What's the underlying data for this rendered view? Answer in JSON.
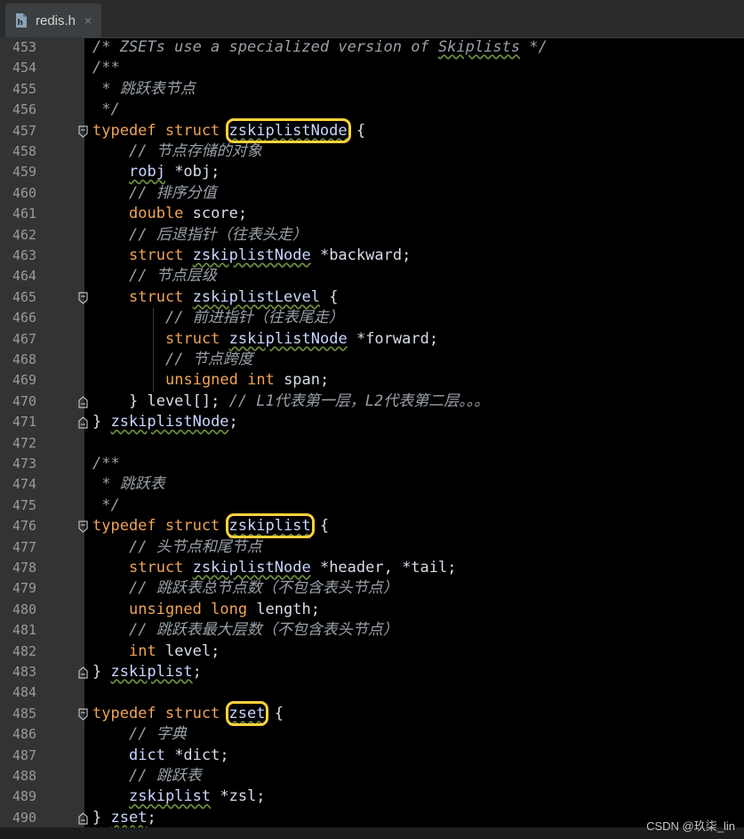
{
  "tab": {
    "filename": "redis.h",
    "close_glyph": "×"
  },
  "watermark": "CSDN @玖柒_lin",
  "colors": {
    "keyword": "#f0a357",
    "comment": "#9aa0a8",
    "highlight_box": "#ffd23b",
    "background": "#000000"
  },
  "lines": [
    {
      "n": "453",
      "indent": 0,
      "parts": [
        [
          "cm",
          "/* ZSETs use a specialized version of "
        ],
        [
          "cm sq",
          "Skiplists"
        ],
        [
          "cm",
          " */"
        ]
      ]
    },
    {
      "n": "454",
      "indent": 0,
      "parts": [
        [
          "cm",
          "/**"
        ]
      ]
    },
    {
      "n": "455",
      "indent": 0,
      "parts": [
        [
          "cm",
          " * 跳跃表节点"
        ]
      ]
    },
    {
      "n": "456",
      "indent": 0,
      "parts": [
        [
          "cm",
          " */"
        ]
      ]
    },
    {
      "n": "457",
      "indent": 0,
      "fold": "open",
      "parts": [
        [
          "kw",
          "typedef struct "
        ],
        [
          "ty sq hl",
          "zskiplistNode"
        ],
        [
          "id",
          " {"
        ]
      ]
    },
    {
      "n": "458",
      "indent": 1,
      "parts": [
        [
          "cm",
          "// 节点存储的对象"
        ]
      ]
    },
    {
      "n": "459",
      "indent": 1,
      "parts": [
        [
          "ty sq",
          "robj"
        ],
        [
          "id",
          " *obj;"
        ]
      ]
    },
    {
      "n": "460",
      "indent": 1,
      "parts": [
        [
          "cm",
          "// 排序分值"
        ]
      ]
    },
    {
      "n": "461",
      "indent": 1,
      "parts": [
        [
          "kw",
          "double "
        ],
        [
          "id",
          "score;"
        ]
      ]
    },
    {
      "n": "462",
      "indent": 1,
      "parts": [
        [
          "cm",
          "// 后退指针（往表头走）"
        ]
      ]
    },
    {
      "n": "463",
      "indent": 1,
      "parts": [
        [
          "kw",
          "struct "
        ],
        [
          "ty sq",
          "zskiplistNode"
        ],
        [
          "id",
          " *backward;"
        ]
      ]
    },
    {
      "n": "464",
      "indent": 1,
      "parts": [
        [
          "cm",
          "// 节点层级"
        ]
      ]
    },
    {
      "n": "465",
      "indent": 1,
      "fold": "open",
      "parts": [
        [
          "kw",
          "struct "
        ],
        [
          "ty sq",
          "zskiplistLevel"
        ],
        [
          "id",
          " {"
        ]
      ]
    },
    {
      "n": "466",
      "indent": 2,
      "parts": [
        [
          "cm",
          "// 前进指针（往表尾走）"
        ]
      ]
    },
    {
      "n": "467",
      "indent": 2,
      "parts": [
        [
          "kw",
          "struct "
        ],
        [
          "ty sq",
          "zskiplistNode"
        ],
        [
          "id",
          " *forward;"
        ]
      ]
    },
    {
      "n": "468",
      "indent": 2,
      "parts": [
        [
          "cm",
          "// 节点跨度"
        ]
      ]
    },
    {
      "n": "469",
      "indent": 2,
      "parts": [
        [
          "kw",
          "unsigned int "
        ],
        [
          "id",
          "span;"
        ]
      ]
    },
    {
      "n": "470",
      "indent": 1,
      "fold": "close",
      "parts": [
        [
          "id",
          "} level[]; "
        ],
        [
          "cm",
          "// L1代表第一层，L2代表第二层。。。"
        ]
      ]
    },
    {
      "n": "471",
      "indent": 0,
      "fold": "close",
      "parts": [
        [
          "id",
          "} "
        ],
        [
          "ty sq",
          "zskiplistNode"
        ],
        [
          "id",
          ";"
        ]
      ]
    },
    {
      "n": "472",
      "indent": 0,
      "parts": []
    },
    {
      "n": "473",
      "indent": 0,
      "parts": [
        [
          "cm",
          "/**"
        ]
      ]
    },
    {
      "n": "474",
      "indent": 0,
      "parts": [
        [
          "cm",
          " * 跳跃表"
        ]
      ]
    },
    {
      "n": "475",
      "indent": 0,
      "parts": [
        [
          "cm",
          " */"
        ]
      ]
    },
    {
      "n": "476",
      "indent": 0,
      "fold": "open",
      "parts": [
        [
          "kw",
          "typedef struct "
        ],
        [
          "ty sq hl",
          "zskiplist"
        ],
        [
          "id",
          " {"
        ]
      ]
    },
    {
      "n": "477",
      "indent": 1,
      "parts": [
        [
          "cm",
          "// 头节点和尾节点"
        ]
      ]
    },
    {
      "n": "478",
      "indent": 1,
      "parts": [
        [
          "kw",
          "struct "
        ],
        [
          "ty sq",
          "zskiplistNode"
        ],
        [
          "id",
          " *header, *tail;"
        ]
      ]
    },
    {
      "n": "479",
      "indent": 1,
      "parts": [
        [
          "cm",
          "// 跳跃表总节点数（不包含表头节点）"
        ]
      ]
    },
    {
      "n": "480",
      "indent": 1,
      "parts": [
        [
          "kw",
          "unsigned long "
        ],
        [
          "id",
          "length;"
        ]
      ]
    },
    {
      "n": "481",
      "indent": 1,
      "parts": [
        [
          "cm",
          "// 跳跃表最大层数（不包含表头节点）"
        ]
      ]
    },
    {
      "n": "482",
      "indent": 1,
      "parts": [
        [
          "kw",
          "int "
        ],
        [
          "id",
          "level;"
        ]
      ]
    },
    {
      "n": "483",
      "indent": 0,
      "fold": "close",
      "parts": [
        [
          "id",
          "} "
        ],
        [
          "ty sq",
          "zskiplist"
        ],
        [
          "id",
          ";"
        ]
      ]
    },
    {
      "n": "484",
      "indent": 0,
      "parts": []
    },
    {
      "n": "485",
      "indent": 0,
      "fold": "open",
      "parts": [
        [
          "kw",
          "typedef struct "
        ],
        [
          "ty sq hl",
          "zset"
        ],
        [
          "id",
          " {"
        ]
      ]
    },
    {
      "n": "486",
      "indent": 1,
      "parts": [
        [
          "cm",
          "// 字典"
        ]
      ]
    },
    {
      "n": "487",
      "indent": 1,
      "parts": [
        [
          "ty",
          "dict"
        ],
        [
          "id",
          " *dict;"
        ]
      ]
    },
    {
      "n": "488",
      "indent": 1,
      "parts": [
        [
          "cm",
          "// 跳跃表"
        ]
      ]
    },
    {
      "n": "489",
      "indent": 1,
      "parts": [
        [
          "ty sq",
          "zskiplist"
        ],
        [
          "id",
          " *zsl;"
        ]
      ]
    },
    {
      "n": "490",
      "indent": 0,
      "fold": "close",
      "parts": [
        [
          "id",
          "} "
        ],
        [
          "ty sq",
          "zset"
        ],
        [
          "id",
          ";"
        ]
      ]
    }
  ]
}
